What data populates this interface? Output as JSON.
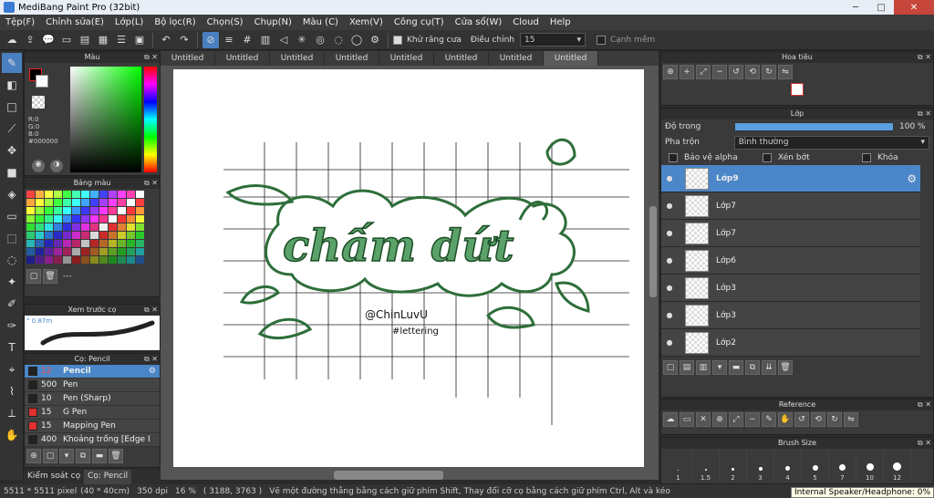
{
  "window": {
    "title": "MediBang Paint Pro (32bit)"
  },
  "menu": [
    "Tệp(F)",
    "Chỉnh sửa(E)",
    "Lớp(L)",
    "Bộ lọc(R)",
    "Chọn(S)",
    "Chụp(N)",
    "Màu (C)",
    "Xem(V)",
    "Công cụ(T)",
    "Cửa sổ(W)",
    "Cloud",
    "Help"
  ],
  "toolbar": {
    "antialias": "Khử răng cưa",
    "adjust_label": "Điều chỉnh",
    "adjust_value": "15",
    "edge_label": "Cạnh mềm"
  },
  "color_panel": {
    "title": "Màu",
    "r": "R:0",
    "g": "G:0",
    "b": "B:0",
    "hex": "#000000"
  },
  "palette_panel": {
    "title": "Bảng màu",
    "dots": "---"
  },
  "preview_panel": {
    "title": "Xem trước cọ",
    "size": "0.87m"
  },
  "brush_panel": {
    "title": "Cọ: Pencil",
    "items": [
      {
        "size": "12",
        "name": "Pencil",
        "color": "#222222"
      },
      {
        "size": "500",
        "name": "Pen",
        "color": "#222222"
      },
      {
        "size": "10",
        "name": "Pen (Sharp)",
        "color": "#222222"
      },
      {
        "size": "15",
        "name": "G Pen",
        "color": "#e03030"
      },
      {
        "size": "15",
        "name": "Mapping Pen",
        "color": "#e03030"
      },
      {
        "size": "400",
        "name": "Khoảng trống [Edge I",
        "color": "#222222"
      }
    ]
  },
  "left_bottom_tabs": [
    "Kiểm soát cọ",
    "Cọ: Pencil"
  ],
  "tabs": [
    "Untitled",
    "Untitled",
    "Untitled",
    "Untitled",
    "Untitled",
    "Untitled",
    "Untitled",
    "Untitled"
  ],
  "navigator": {
    "title": "Hoa tiêu"
  },
  "layer_panel": {
    "title": "Lớp",
    "opacity_label": "Độ trong",
    "opacity_value": "100 %",
    "blend_label": "Pha trộn",
    "blend_value": "Bình thường",
    "protect_alpha": "Bảo vệ alpha",
    "clipping": "Xén bớt",
    "lock": "Khóa",
    "layers": [
      "Lớp9",
      "Lớp7",
      "Lớp7",
      "Lớp6",
      "Lớp3",
      "Lớp3",
      "Lớp2"
    ]
  },
  "reference": {
    "title": "Reference"
  },
  "brush_size": {
    "title": "Brush Size",
    "sizes": [
      "1",
      "1.5",
      "2",
      "3",
      "4",
      "5",
      "7",
      "10",
      "12"
    ]
  },
  "artwork": {
    "title": "chấm dứt",
    "signature": "@ChinLuvU",
    "hashtag": "#lettering"
  },
  "status": {
    "size": "5511 * 5511 pixel",
    "cm": "(40 * 40cm)",
    "dpi": "350 dpi",
    "zoom": "16 %",
    "coords": "( 3188, 3763 )",
    "hint": "Vẽ một đường thẳng bằng cách giữ phím Shift, Thay đổi cỡ cọ bằng cách giữ phím Ctrl, Alt và kéo",
    "speaker": "Internal Speaker/Headphone: 0%"
  }
}
